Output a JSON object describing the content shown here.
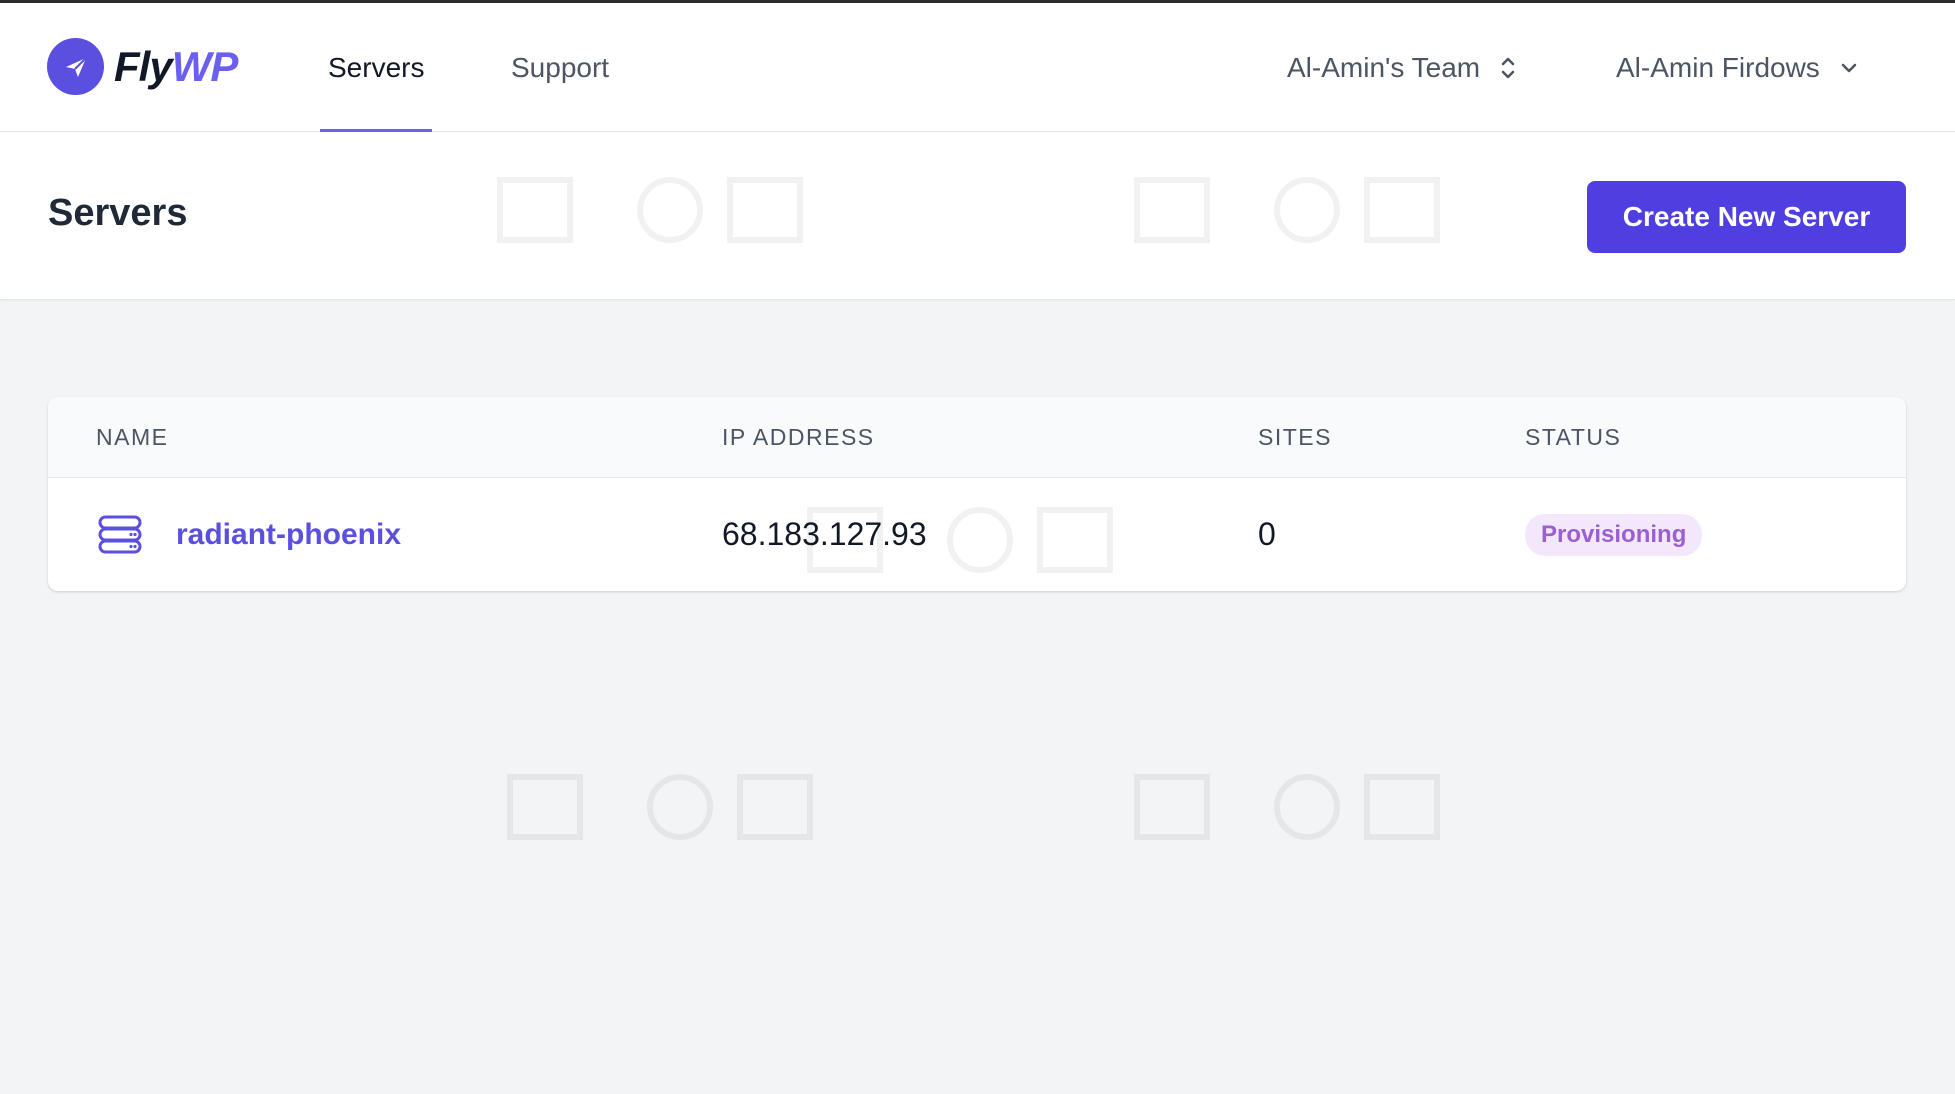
{
  "brand": {
    "name_part1": "Fly",
    "name_part2": "WP",
    "colors": {
      "accent": "#5b4fe0",
      "button": "#4f3ee0",
      "badge_bg": "#f3e8fb",
      "badge_text": "#9b5fcf"
    }
  },
  "nav": {
    "tabs": [
      {
        "label": "Servers",
        "active": true
      },
      {
        "label": "Support",
        "active": false
      }
    ],
    "team": {
      "label": "Al-Amin's Team",
      "icon": "chevron-up-down-icon"
    },
    "user": {
      "label": "Al-Amin Firdows",
      "icon": "chevron-down-icon"
    }
  },
  "page": {
    "title": "Servers",
    "create_button_label": "Create New Server"
  },
  "table": {
    "columns": [
      "NAME",
      "IP ADDRESS",
      "SITES",
      "STATUS"
    ],
    "rows": [
      {
        "name": "radiant-phoenix",
        "icon": "server-icon",
        "ip": "68.183.127.93",
        "sites": "0",
        "status": "Provisioning"
      }
    ]
  }
}
